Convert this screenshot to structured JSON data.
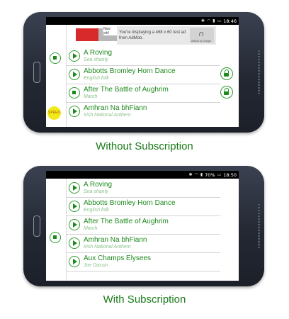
{
  "colors": {
    "accent": "#1b8a1b",
    "subtitle": "#8cc28c",
    "badge": "#f1ea1a"
  },
  "phone1": {
    "status_time": "18:46",
    "battery": "",
    "ad": {
      "tag": "Nice job!",
      "text": "You're displaying a 468 x 60 test ad from AdMob.",
      "logo_caption": "AdMob by Google"
    },
    "badge_label": "SPEED",
    "rows": [
      {
        "title": "A Roving",
        "sub": "Sea shanty",
        "state": "play"
      },
      {
        "title": "Abbotts Bromley Horn Dance",
        "sub": "English folk",
        "state": "stop",
        "locked": true
      },
      {
        "title": "After The Battle of Aughrim",
        "sub": "March",
        "state": "stop",
        "locked": true
      },
      {
        "title": "Amhran Na bhFiann",
        "sub": "Irish National Anthem",
        "state": "play"
      }
    ],
    "caption": "Without Subscription"
  },
  "phone2": {
    "status_time": "18:50",
    "battery": "70%",
    "rows": [
      {
        "title": "A Roving",
        "sub": "Sea shanty",
        "state": "play"
      },
      {
        "title": "Abbotts Bromley Horn Dance",
        "sub": "English folk",
        "state": "play"
      },
      {
        "title": "After The Battle of Aughrim",
        "sub": "March",
        "state": "play"
      },
      {
        "title": "Amhran Na bhFiann",
        "sub": "Irish National Anthem",
        "state": "play"
      },
      {
        "title": "Aux Champs Elysees",
        "sub": "Joe Dassin",
        "state": "play"
      }
    ],
    "caption": "With Subscription"
  }
}
